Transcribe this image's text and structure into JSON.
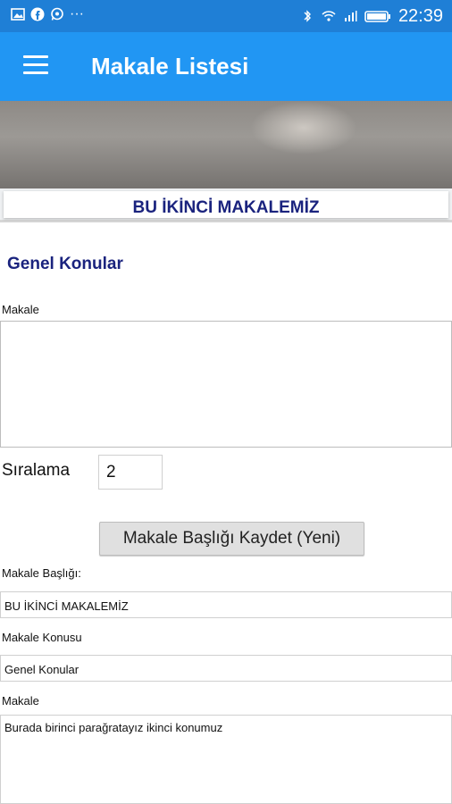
{
  "status_bar": {
    "left_icons": [
      "gallery-icon",
      "facebook-icon",
      "whatsapp-icon",
      "more-icon"
    ],
    "right_icons": [
      "bluetooth-icon",
      "wifi-icon",
      "signal-icon",
      "battery-icon"
    ],
    "more": "···",
    "time": "22:39"
  },
  "app_bar": {
    "title": "Makale Listesi",
    "color": "#2196f3"
  },
  "article": {
    "heading": "BU İKİNCİ MAKALEMİZ",
    "category": "Genel Konular"
  },
  "form": {
    "makale_label": "Makale",
    "siralama_label": "Sıralama",
    "siralama_value": "2",
    "save_button": "Makale Başlığı Kaydet (Yeni)",
    "baslik_label": "Makale Başlığı:",
    "baslik_value": "BU İKİNCİ MAKALEMİZ",
    "konu_label": "Makale Konusu",
    "konu_value": "Genel Konular",
    "content_label": "Makale",
    "content_value": "Burada birinci parağratayız ikinci konumuz"
  }
}
